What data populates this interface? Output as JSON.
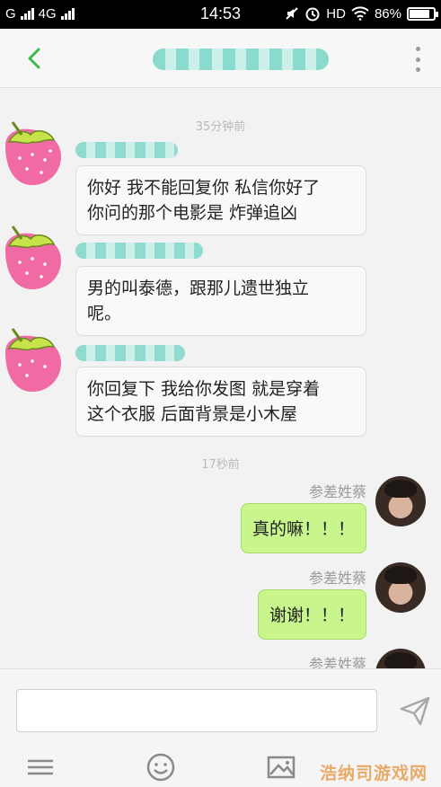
{
  "status_bar": {
    "carrier_1": "G",
    "carrier_2": "4G",
    "time": "14:53",
    "network": "HD",
    "battery": "86%",
    "battery_level": 0.86
  },
  "header": {
    "back_icon": "chevron-left-icon",
    "menu_icon": "more-vertical-icon"
  },
  "chat": {
    "timestamps": [
      "35分钟前",
      "17秒前"
    ],
    "incoming": [
      {
        "text_lines": [
          "你好 我不能回复你 私信你好了",
          "你问的那个电影是 炸弹追凶"
        ]
      },
      {
        "text_lines": [
          "男的叫泰德，跟那儿遗世独立",
          "呢。"
        ]
      },
      {
        "text_lines": [
          "你回复下 我给你发图 就是穿着",
          "这个衣服 后面背景是小木屋"
        ]
      }
    ],
    "outgoing": [
      {
        "sender": "参差姓蔡",
        "text": "真的嘛！！！"
      },
      {
        "sender": "参差姓蔡",
        "text": "谢谢！！！"
      },
      {
        "sender": "参差姓蔡"
      }
    ]
  },
  "input_bar": {
    "placeholder": "",
    "tools": [
      "keyboard-icon",
      "emoji-icon",
      "image-icon"
    ],
    "send_icon": "send-icon"
  },
  "watermark": "浩纳司游戏网",
  "colors": {
    "accent": "#3cb94a",
    "outgoing_bubble": "#c8f58c",
    "incoming_bubble": "#f9f9f9"
  }
}
